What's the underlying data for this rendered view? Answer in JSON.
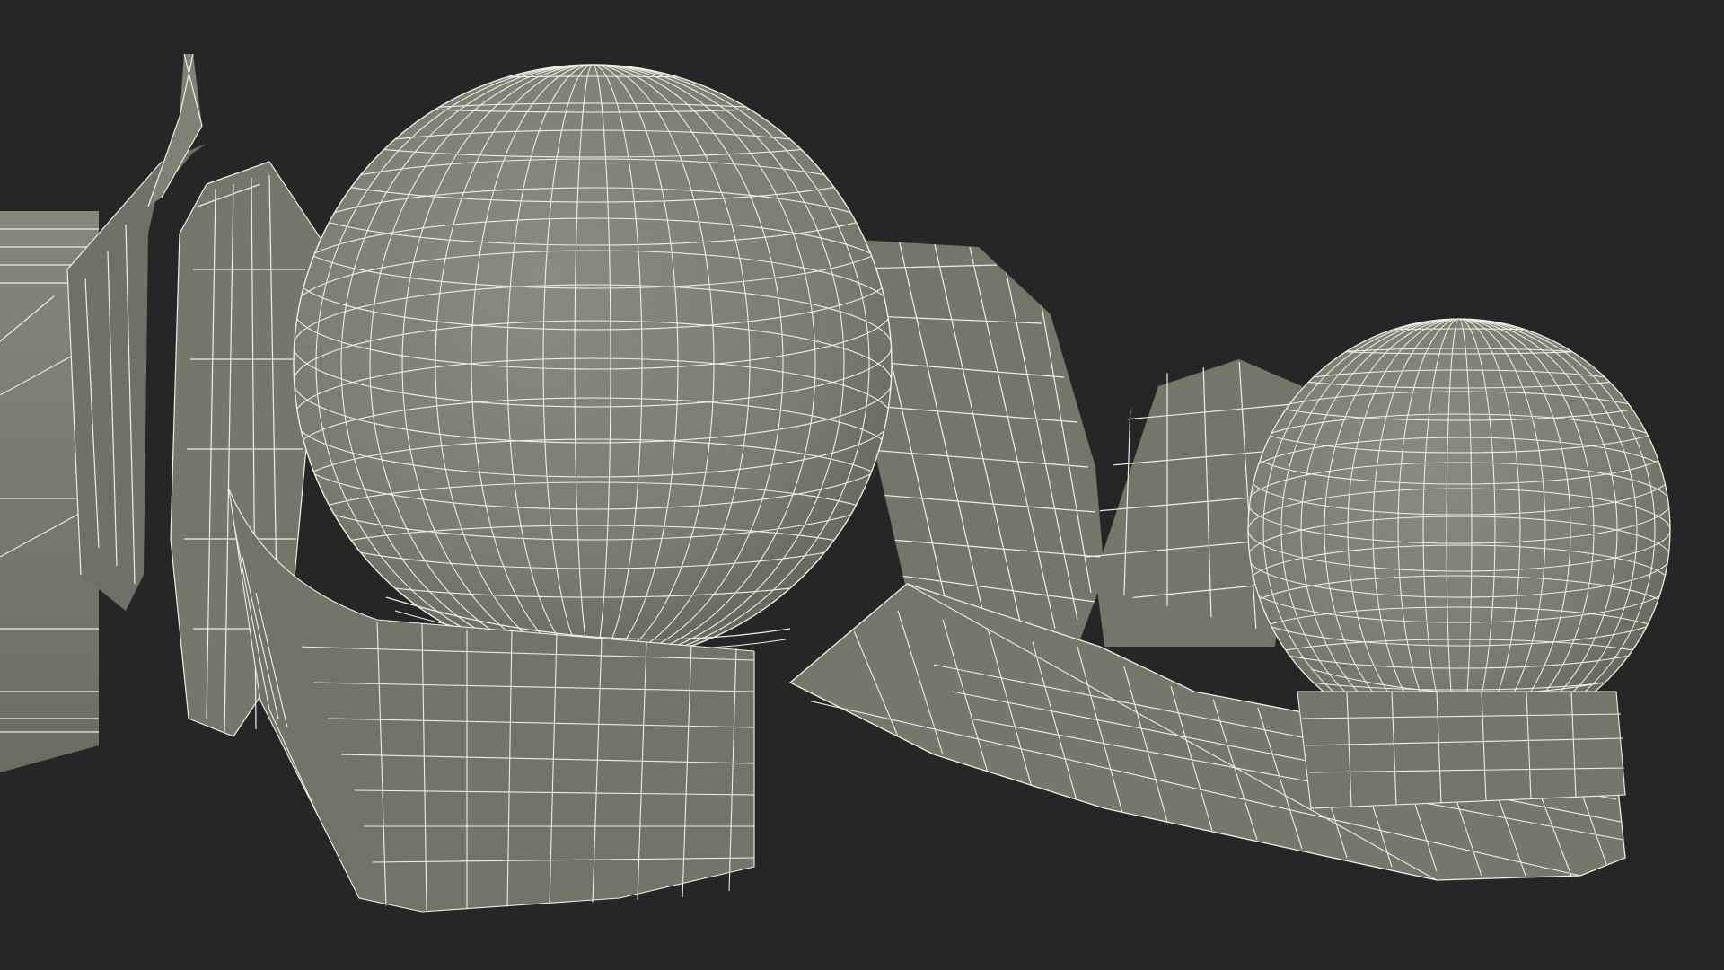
{
  "scene": {
    "background_color": "#262626",
    "surface_color": "#7b7c70",
    "surface_shade_color": "#66675d",
    "surface_light_color": "#8a8b7f",
    "wire_color": "#efeee4"
  }
}
